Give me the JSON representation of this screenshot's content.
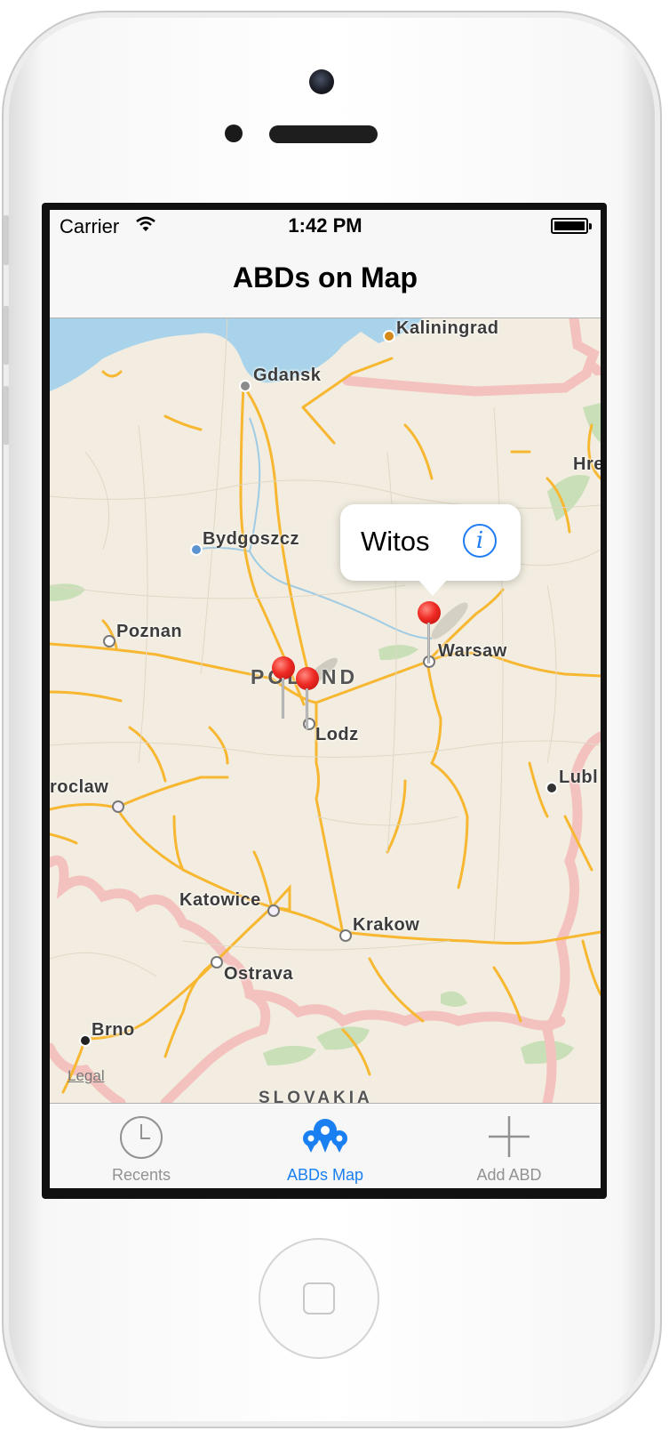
{
  "status_bar": {
    "carrier": "Carrier",
    "time": "1:42 PM"
  },
  "navbar": {
    "title": "ABDs on Map"
  },
  "map": {
    "cities": [
      "Kaliningrad",
      "Gdansk",
      "Bydgoszcz",
      "Poznan",
      "Warsaw",
      "Lodz",
      "roclaw",
      "Lubl",
      "Katowice",
      "Krakow",
      "Ostrava",
      "Brno",
      "Hre"
    ],
    "country_labels": [
      "POLAND",
      "SLOVAKIA"
    ],
    "legal": "Legal",
    "callout": {
      "title": "Witos"
    }
  },
  "tabbar": {
    "tabs": [
      {
        "label": "Recents",
        "icon": "clock-icon",
        "active": false
      },
      {
        "label": "ABDs Map",
        "icon": "abd-map-icon",
        "active": true
      },
      {
        "label": "Add ABD",
        "icon": "plus-icon",
        "active": false
      }
    ]
  },
  "colors": {
    "accent": "#1a7ff0",
    "pin": "#ef2b24",
    "water": "#a8d3ea",
    "road": "#f7b731",
    "border": "#f4c2be"
  }
}
